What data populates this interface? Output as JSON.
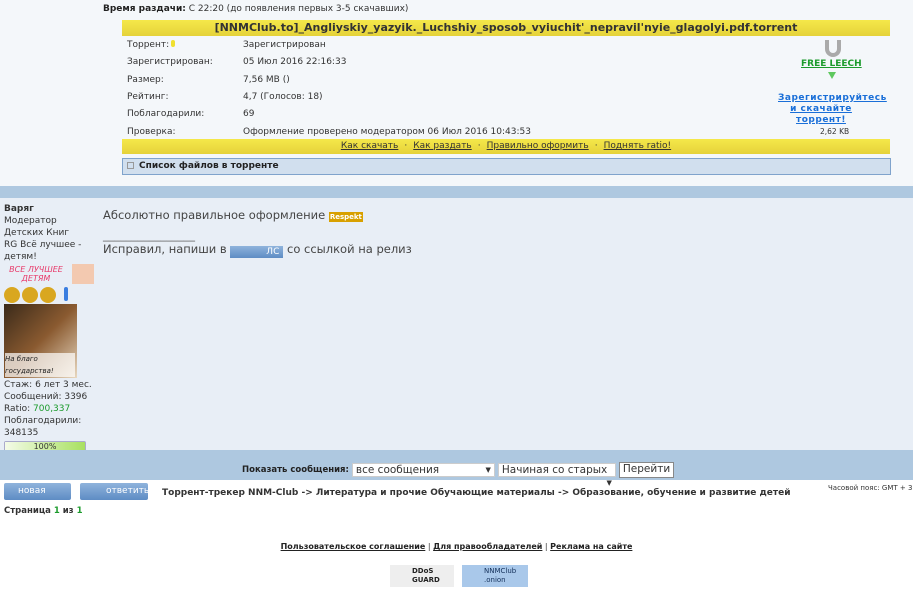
{
  "release_time": {
    "label": "Время раздачи:",
    "value": "С 22:20 (до появления первых 3-5 скачавших)"
  },
  "torrent": {
    "title": "[NNMClub.to]_Angliyskiy_yazyik._Luchshiy_sposob_vyiuchit'_nepravil'nyie_glagolyi.pdf.torrent",
    "rows": [
      {
        "label": "Торрент:",
        "value": "Зарегистрирован"
      },
      {
        "label": "Зарегистрирован:",
        "value": "05 Июл 2016 22:16:33"
      },
      {
        "label": "Размер:",
        "value": "7,56 MB  ()"
      },
      {
        "label": "Рейтинг:",
        "value": "4,7 (Голосов: 18)"
      },
      {
        "label": "Поблагодарили:",
        "value": "69"
      },
      {
        "label": "Проверка:",
        "value": "Оформление проверено модератором 06 Июл 2016 10:43:53"
      }
    ],
    "free_leech": "FREE LEECH",
    "register_link": "Зарегистрируйтесь и скачайте торрент!",
    "file_size": "2,62 KB",
    "links": [
      "Как скачать",
      "Как раздать",
      "Правильно оформить",
      "Поднять ratio!"
    ],
    "file_list": "Список файлов в торренте"
  },
  "post": {
    "author": "Варяг",
    "role": "Модератор Детских Книг",
    "group": "RG Всё лучшее - детям!",
    "banner": "ВСЕ ЛУЧШЕЕ ДЕТЯМ",
    "avatar_text": "На благо государства!",
    "stats": [
      {
        "label": "Стаж:",
        "value": "6 лет 3 мес."
      },
      {
        "label": "Сообщений:",
        "value": "3396"
      },
      {
        "label": "Ratio:",
        "value": "700,337"
      },
      {
        "label": "Поблагодарили:",
        "value": "348135"
      }
    ],
    "progress": "100%",
    "progress_value": 100,
    "line1": "Абсолютно правильное оформление",
    "respekt": "Respekt",
    "divider": "________________",
    "line2a": "Исправил, напиши в",
    "pm": "ЛС",
    "line2b": "со ссылкой на релиз"
  },
  "controls": {
    "show_label": "Показать сообщения:",
    "filter": "все сообщения",
    "order": "Начиная со старых",
    "go": "Перейти"
  },
  "nav": {
    "new_topic": "новая тема",
    "reply": "ответить",
    "breadcrumb": "Торрент-трекер NNM-Club -> Литература и прочие Обучающие материалы -> Образование, обучение и развитие детей",
    "timezone": "Часовой пояс: GMT + 3",
    "page_label": "Страница",
    "page": "1",
    "of": "из",
    "total": "1"
  },
  "footer": {
    "links": [
      "Пользовательское соглашение",
      "Для правообладателей",
      "Реклама на сайте"
    ],
    "ddos": "DDoS GUARD",
    "onion": "NNMClub .onion"
  },
  "colors": {
    "header_yellow": "#f5e84a",
    "band_blue": "#aec8e0",
    "post_bg": "#e8eef6",
    "link_blue": "#1a6fd8",
    "green": "#1c9b2c"
  }
}
